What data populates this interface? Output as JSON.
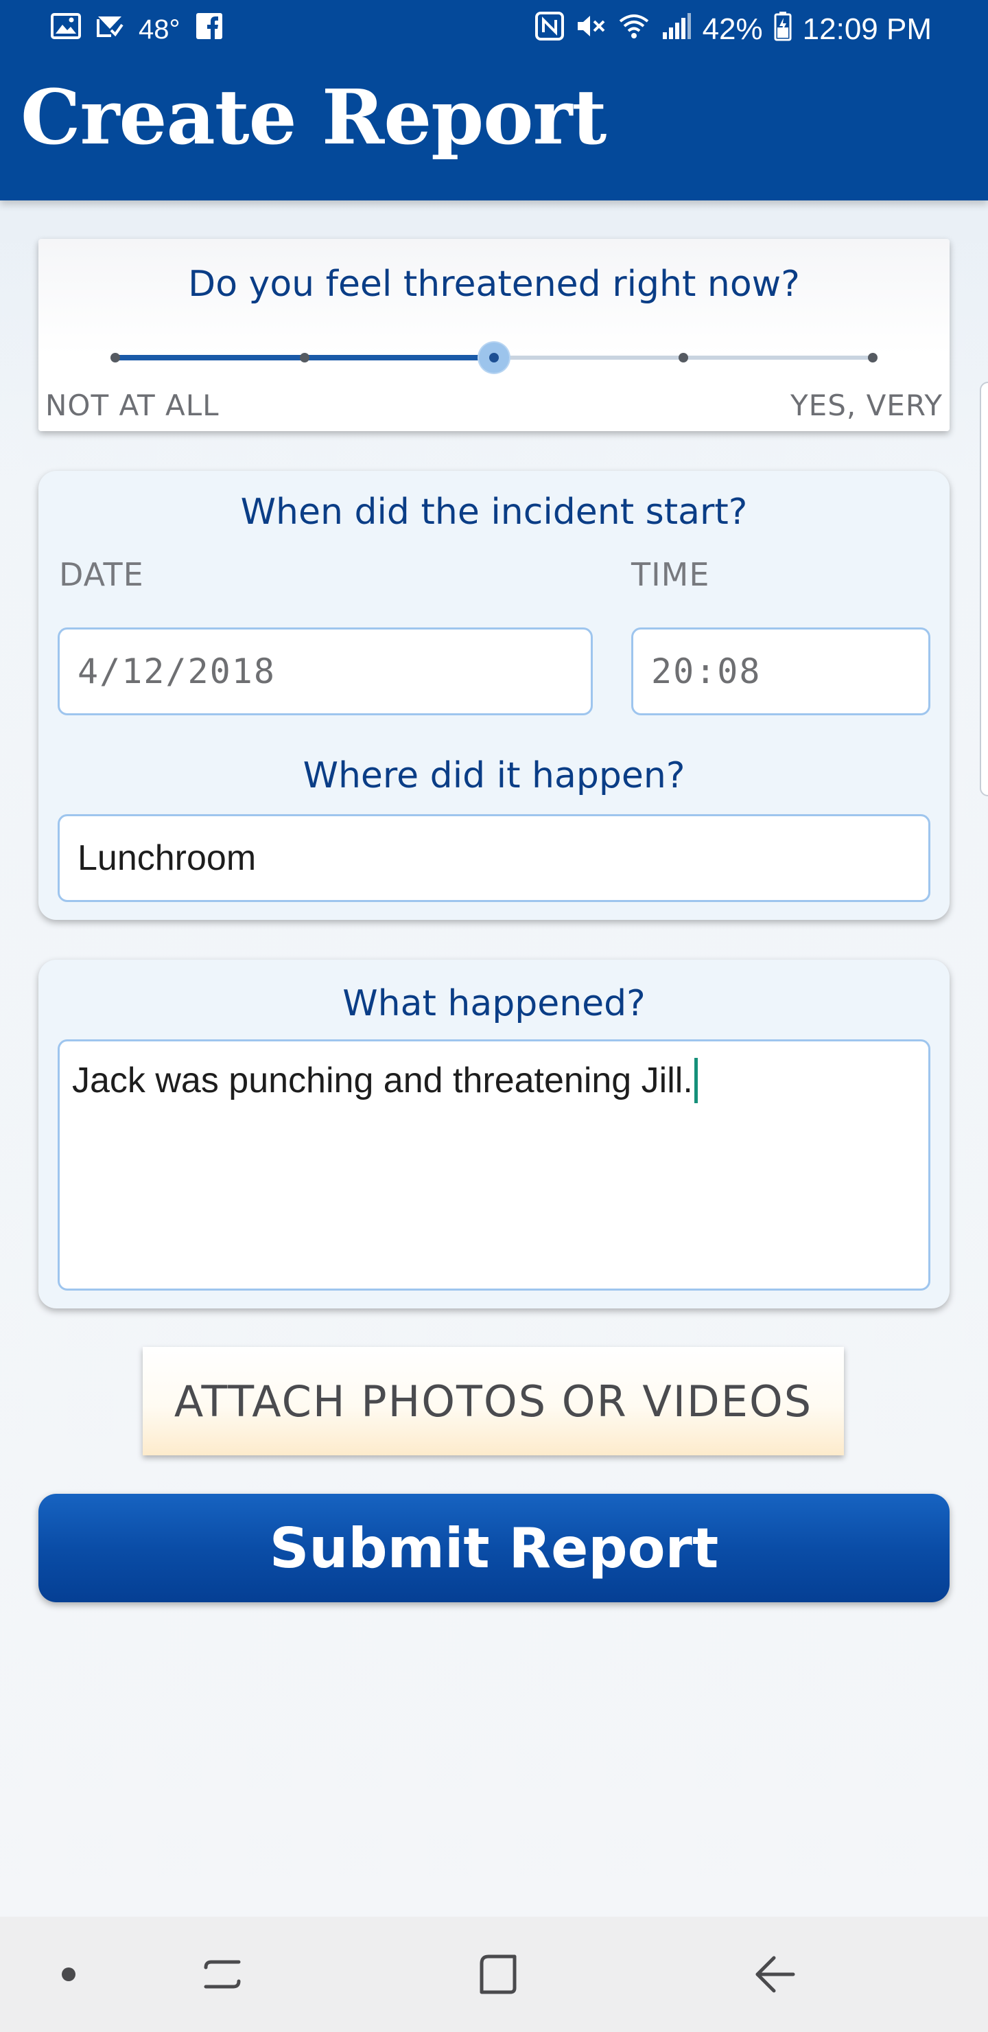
{
  "status_bar": {
    "temperature": "48°",
    "battery": "42%",
    "time": "12:09 PM",
    "icons": [
      "image-icon",
      "mail-check-icon",
      "facebook-icon",
      "nfc-icon",
      "mute-icon",
      "wifi-icon",
      "signal-icon",
      "battery-icon"
    ]
  },
  "header": {
    "title": "Create Report"
  },
  "threat": {
    "question": "Do you feel threatened right now?",
    "min_label": "NOT AT ALL",
    "max_label": "YES, VERY",
    "steps": 5,
    "selected_step": 3
  },
  "incident": {
    "start_question": "When did the incident start?",
    "date_label": "DATE",
    "date_value": "4/12/2018",
    "time_label": "TIME",
    "time_value": "20:08",
    "where_question": "Where did it happen?",
    "where_value": "Lunchroom"
  },
  "description": {
    "question": "What happened?",
    "value": "Jack was punching and threatening Jill."
  },
  "actions": {
    "attach_label": "ATTACH PHOTOS OR VIDEOS",
    "submit_label": "Submit Report"
  },
  "colors": {
    "header_bg": "#04499a",
    "question_text": "#0a3d86",
    "field_border": "#9ec5ee",
    "submit_bg": "#0a4da7"
  },
  "nav_bar": {
    "icons": [
      "dot-icon",
      "recent-apps-icon",
      "home-icon",
      "back-icon"
    ]
  }
}
